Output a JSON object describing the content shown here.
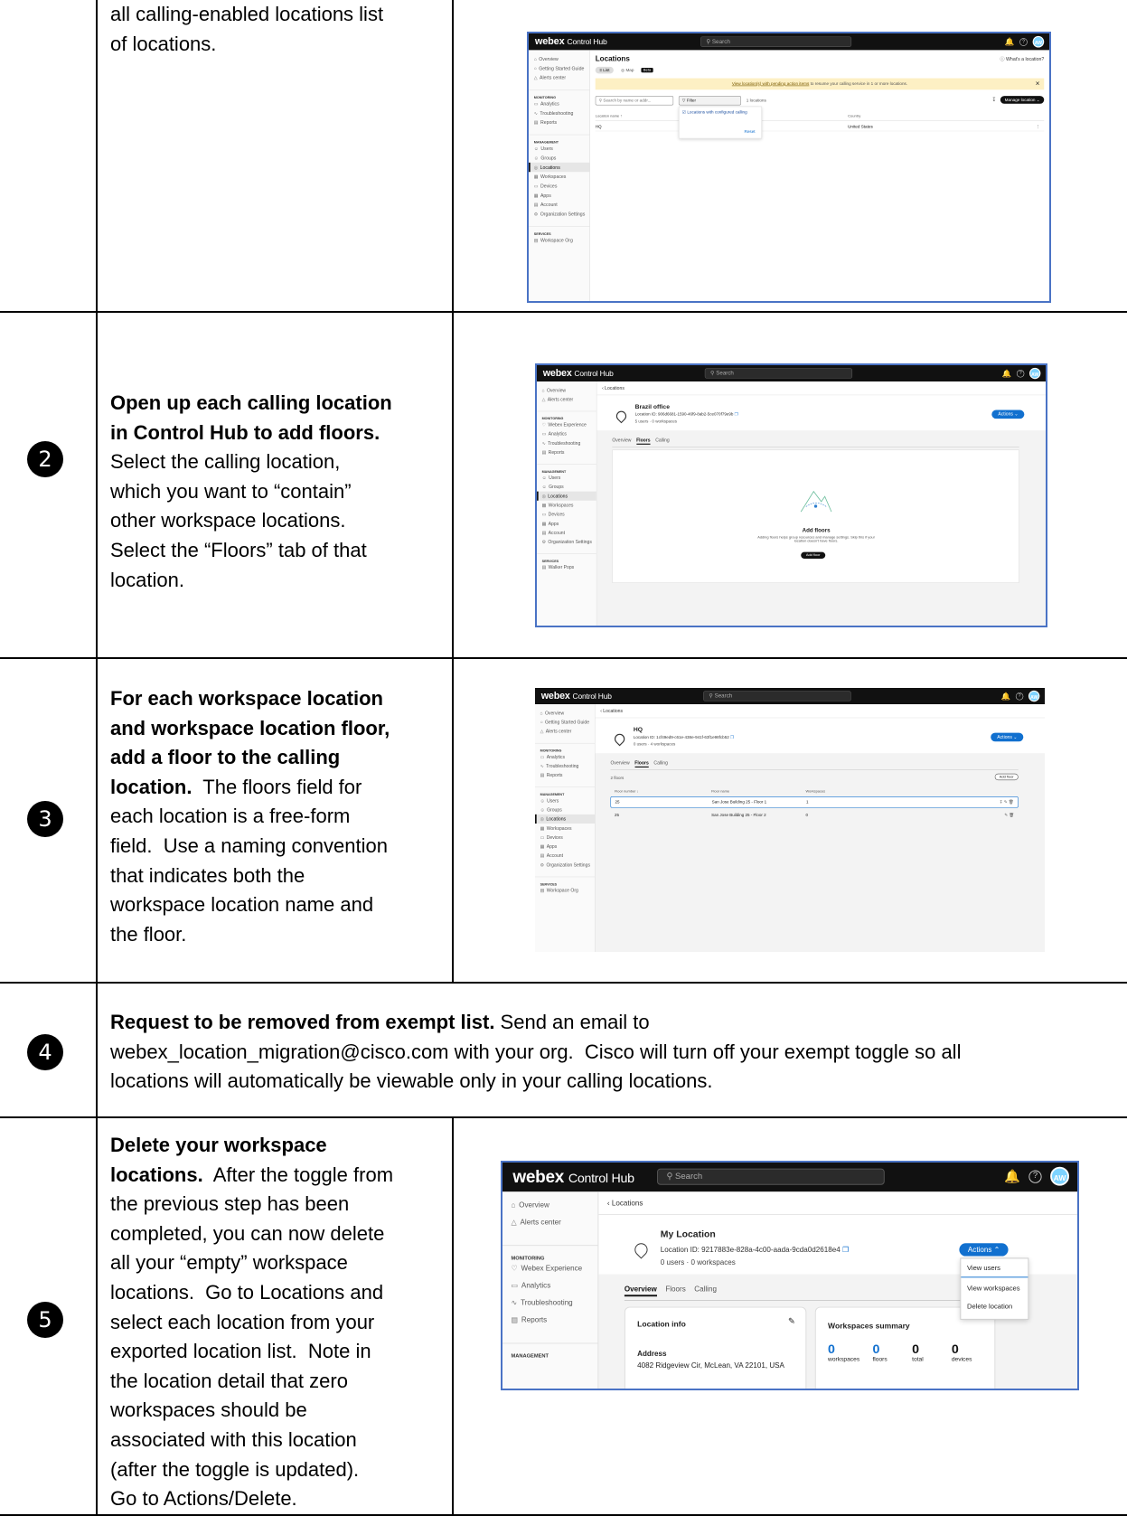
{
  "steps": [
    {
      "num": "",
      "lines_plain": [
        "all calling-enabled locations list",
        "of locations."
      ]
    },
    {
      "num": "2",
      "bold": [
        "Open up each calling location",
        "in Control Hub to add floors."
      ],
      "plain": [
        "Select the calling location,",
        "which you want to “contain”",
        "other workspace locations.",
        "Select the “Floors” tab of that",
        "location."
      ]
    },
    {
      "num": "3",
      "l1": "For each workspace location",
      "l2": "and workspace location floor,",
      "l3": "add a floor to the calling",
      "l4b": "location.",
      "l4": "  The floors field for",
      "l5": "each location is a free-form",
      "l6": "field.  Use a naming convention",
      "l7": "that indicates both the",
      "l8": "workspace location name and",
      "l9": "the floor."
    },
    {
      "num": "4",
      "bold": "Request to be removed from exempt list.",
      "l1": " Send an email to",
      "l2": "webex_location_migration@cisco.com with your org.  Cisco will turn off your exempt toggle so all",
      "l3": "locations will automatically be viewable only in your calling locations."
    },
    {
      "num": "5",
      "l1b": "Delete your workspace",
      "l2b": "locations.",
      "l2": "  After the toggle from",
      "l3": "the previous step has been",
      "l4": "completed, you can now delete",
      "l5": "all your “empty” workspace",
      "l6": "locations.  Go to Locations and",
      "l7": "select each location from your",
      "l8": "exported location list.  Note in",
      "l9": "the location detail that zero",
      "l10": "workspaces should be",
      "l11": "associated with this location",
      "l12": "(after the toggle is updated).",
      "l13": "Go to Actions/Delete."
    }
  ],
  "app": {
    "brand": "webex",
    "product": "Control Hub",
    "search": "Search",
    "avatar": "AW",
    "help": "?"
  },
  "shot1": {
    "sidebar": [
      "Overview",
      "Getting Started Guide",
      "Alerts center",
      "MONITORING",
      "Analytics",
      "Troubleshooting",
      "Reports",
      "MANAGEMENT",
      "Users",
      "Groups",
      "Locations",
      "Workspaces",
      "Devices",
      "Apps",
      "Account",
      "Organization Settings",
      "SERVICES",
      "Workspace Org"
    ],
    "title": "Locations",
    "whats": "What's a location?",
    "tab_list": "List",
    "tab_map": "Map",
    "beta": "Beta",
    "banner_link": "View location(s) with pending action items",
    "banner_rest": " to resume your calling service in 1 or more locations.",
    "search_ph": "Search by name or addr...",
    "filter": "Filter",
    "count": "1 locations",
    "dropdown_item": "Locations with configured calling",
    "reset": "Reset",
    "manage": "Manage location",
    "col_name": "Location name ↑",
    "col_country": "Country",
    "row_name": "HQ",
    "row_country": "United States"
  },
  "shot2": {
    "sidebar": [
      "Overview",
      "Alerts center",
      "MONITORING",
      "Webex Experience",
      "Analytics",
      "Troubleshooting",
      "Reports",
      "MANAGEMENT",
      "Users",
      "Groups",
      "Locations",
      "Workspaces",
      "Devices",
      "Apps",
      "Account",
      "Organization Settings",
      "SERVICES",
      "Walker Pops"
    ],
    "crumb": "Locations",
    "name": "Brazil office",
    "id": "Location ID: 906d6681-1590-46f9-8ab2-5ce070f79e9b",
    "meta": "5 users  ·  0 workspaces",
    "actions": "Actions",
    "tabs": [
      "Overview",
      "Floors",
      "Calling"
    ],
    "empty_title": "Add floors",
    "empty_l1": "Adding floors helps group resources and manage settings. Skip this if your",
    "empty_l2": "location doesn't have floors.",
    "add": "Add floor"
  },
  "shot3": {
    "sidebar": [
      "Overview",
      "Getting Started Guide",
      "Alerts center",
      "MONITORING",
      "Analytics",
      "Troubleshooting",
      "Reports",
      "MANAGEMENT",
      "Users",
      "Groups",
      "Locations",
      "Workspaces",
      "Devices",
      "Apps",
      "Account",
      "Organization Settings",
      "SERVICES",
      "Workspace Org"
    ],
    "crumb": "Locations",
    "name": "HQ",
    "id": "Location ID: 1cf49ed9-c61e-438e-941f-63f1e98fcb52",
    "meta": "0 users  ·  4 workspaces",
    "actions": "Actions",
    "tabs": [
      "Overview",
      "Floors",
      "Calling"
    ],
    "floors_count": "2 floors",
    "add": "Add floor",
    "cols": [
      "Floor number ↓",
      "Floor name",
      "Workspaces"
    ],
    "rows": [
      [
        "25",
        "San Jose Building 25 - Floor 1",
        "1"
      ],
      [
        "25",
        "San Jose Building 25 - Floor 2",
        "0"
      ]
    ]
  },
  "shot5": {
    "sidebar": [
      "Overview",
      "Alerts center",
      "MONITORING",
      "Webex Experience",
      "Analytics",
      "Troubleshooting",
      "Reports",
      "MANAGEMENT"
    ],
    "crumb": "Locations",
    "name": "My Location",
    "id": "Location ID: 9217883e-828a-4c00-aada-9cda0d2618e4",
    "meta": "0 users  ·  0 workspaces",
    "actions": "Actions",
    "menu": [
      "View users",
      "View workspaces",
      "Delete location"
    ],
    "tabs": [
      "Overview",
      "Floors",
      "Calling"
    ],
    "info_title": "Location info",
    "addr_label": "Address",
    "addr": "4082 Ridgeview Cir, McLean, VA 22101, USA",
    "ws_title": "Workspaces summary",
    "stats": [
      [
        "0",
        "workspaces"
      ],
      [
        "0",
        "floors"
      ],
      [
        "0",
        "total"
      ],
      [
        "0",
        "devices"
      ]
    ]
  }
}
